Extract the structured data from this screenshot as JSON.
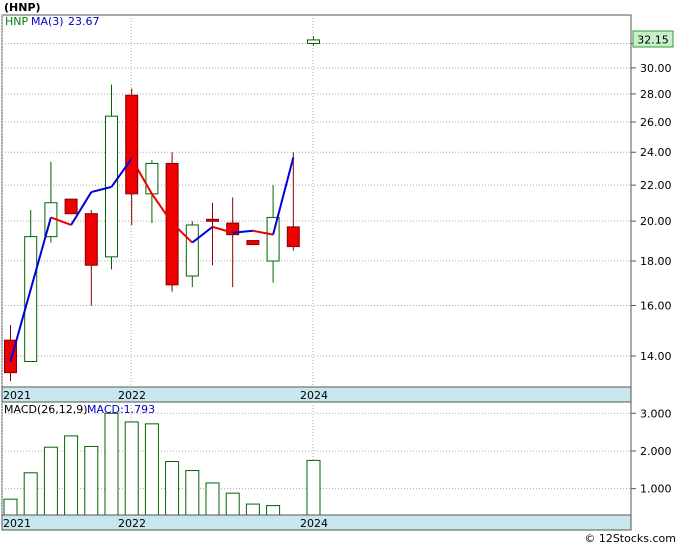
{
  "header": {
    "ticker_label": "(HNP)",
    "ma_ticker": "HNP",
    "ma_label": "MA(3)",
    "ma_value": "23.67",
    "macd_label": "MACD(26,12,9)",
    "macd_value_label": "MACD:1.793",
    "watermark": "© 12Stocks.com"
  },
  "colors": {
    "up_candle_fill": "#ffffff",
    "up_candle_border": "#006400",
    "down_candle_fill": "#ee0000",
    "down_candle_border": "#880000",
    "ma_up": "#0000dd",
    "ma_down": "#ee0000",
    "price_badge": "#c8f0c8",
    "axis_band": "#c8e6ee",
    "grid": "#aaaaaa"
  },
  "chart_data": [
    {
      "type": "candlestick",
      "title": "(HNP)",
      "price_badge": "32.15",
      "y_scale": "log",
      "ylim": [
        12.9,
        34.5
      ],
      "y_ticks": [
        "14.00",
        "16.00",
        "18.00",
        "20.00",
        "22.00",
        "24.00",
        "26.00",
        "28.00",
        "30.00",
        "32.00"
      ],
      "x_tick_labels": [
        "2021",
        "2022",
        "2024"
      ],
      "grid": true,
      "candles": [
        {
          "open": 14.6,
          "high": 15.2,
          "low": 13.1,
          "close": 13.4
        },
        {
          "open": 13.8,
          "high": 20.6,
          "low": 13.8,
          "close": 19.2
        },
        {
          "open": 19.2,
          "high": 23.4,
          "low": 18.9,
          "close": 21.0
        },
        {
          "open": 21.2,
          "high": 21.2,
          "low": 20.4,
          "close": 20.4
        },
        {
          "open": 20.4,
          "high": 20.6,
          "low": 16.0,
          "close": 17.8
        },
        {
          "open": 18.2,
          "high": 28.7,
          "low": 17.6,
          "close": 26.4
        },
        {
          "open": 27.9,
          "high": 28.4,
          "low": 19.8,
          "close": 21.5
        },
        {
          "open": 21.5,
          "high": 23.5,
          "low": 19.9,
          "close": 23.3
        },
        {
          "open": 23.3,
          "high": 24.0,
          "low": 16.6,
          "close": 16.9
        },
        {
          "open": 17.3,
          "high": 20.0,
          "low": 16.8,
          "close": 19.8
        },
        {
          "open": 20.1,
          "high": 21.0,
          "low": 17.8,
          "close": 20.0
        },
        {
          "open": 19.9,
          "high": 21.3,
          "low": 16.8,
          "close": 19.3
        },
        {
          "open": 19.0,
          "high": 19.0,
          "low": 18.8,
          "close": 18.8
        },
        {
          "open": 18.0,
          "high": 22.0,
          "low": 17.0,
          "close": 20.2
        },
        {
          "open": 19.7,
          "high": 24.0,
          "low": 18.5,
          "close": 18.7
        },
        {
          "open": 32.0,
          "high": 32.6,
          "low": 31.8,
          "close": 32.3
        }
      ],
      "ma_series": {
        "name": "MA(3)",
        "values": [
          13.8,
          null,
          20.2,
          19.8,
          21.6,
          21.9,
          23.6,
          21.5,
          19.9,
          18.9,
          19.7,
          19.4,
          19.5,
          19.3,
          23.67
        ]
      }
    },
    {
      "type": "bar",
      "title": "MACD(26,12,9)",
      "ylim": [
        0.3,
        3.3
      ],
      "y_ticks": [
        "1.000",
        "2.000",
        "3.000"
      ],
      "x_tick_labels": [
        "2021",
        "2022",
        "2024"
      ],
      "values": [
        0.72,
        1.42,
        2.1,
        2.4,
        2.12,
        3.0,
        2.77,
        2.72,
        1.72,
        1.48,
        1.15,
        0.88,
        0.59,
        0.55,
        null,
        1.75
      ]
    }
  ]
}
